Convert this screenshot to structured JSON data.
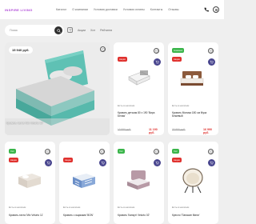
{
  "header": {
    "logo": "INSPIRE LIVING",
    "nav": [
      "Каталог",
      "О компании",
      "Условия доставки",
      "Условия оплаты",
      "Контакты",
      "Отзывы"
    ]
  },
  "search": {
    "placeholder": "Поиск",
    "filters": [
      "Акции",
      "Хит",
      "Рейтинги"
    ]
  },
  "featured": {
    "price": "15 940 руб.",
    "title": "Кровать-тахта 'Mix Velurto 15'"
  },
  "products": [
    {
      "badges": [
        "Акция"
      ],
      "stock": "Есть в наличии",
      "title": "Кровать детская 80 x 190 'Вира Белая'",
      "old_price": "13 990 руб.",
      "new_price": "11 190 руб."
    },
    {
      "badges": [
        "Новинка",
        "Акция"
      ],
      "stock": "Есть в наличии",
      "title": "Кровать Моника 180 см Муза Бежевый",
      "old_price": "33 990 руб.",
      "new_price": "16 990 руб."
    },
    {
      "badges": [
        "Хит",
        "Акция"
      ],
      "stock": "Есть в наличии",
      "title": "Кровать-тахта 'Mix Velurto 11'",
      "old_price": "",
      "new_price": ""
    },
    {
      "badges": [
        "Акция"
      ],
      "stock": "Есть в наличии",
      "title": "Кровать с ящиками 'BON'",
      "old_price": "",
      "new_price": ""
    },
    {
      "badges": [
        "Хит"
      ],
      "stock": "Есть в наличии",
      "title": "Кровать 'Канкун' Velurto 02'",
      "old_price": "",
      "new_price": ""
    },
    {
      "badges": [
        "Хит",
        "Акция"
      ],
      "stock": "Есть в наличии",
      "title": "Кресло 'Папасан Мини'",
      "old_price": "",
      "new_price": ""
    }
  ],
  "colors": {
    "accent": "#48458e",
    "sale": "#e0312e",
    "new": "#3ab54a",
    "logo": "#b04ad8"
  }
}
